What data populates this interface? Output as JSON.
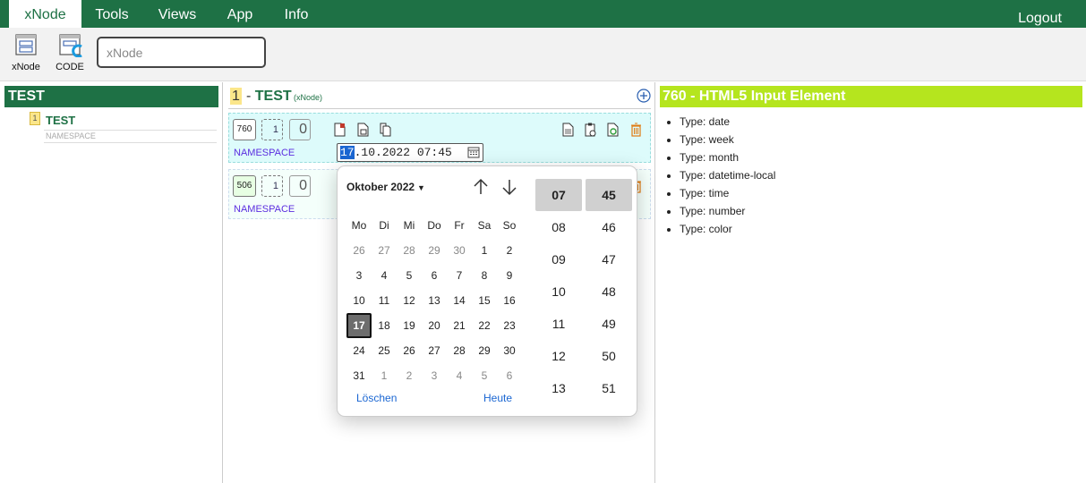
{
  "menubar": {
    "items": [
      {
        "label": "xNode",
        "active": true
      },
      {
        "label": "Tools"
      },
      {
        "label": "Views"
      },
      {
        "label": "App"
      },
      {
        "label": "Info"
      }
    ],
    "logout": "Logout"
  },
  "toolbar": {
    "xnode_label": "xNode",
    "code_label": "CODE",
    "search_placeholder": "xNode"
  },
  "tree": {
    "header": "TEST",
    "badge": "1",
    "name": "TEST",
    "namespace": "NAMESPACE"
  },
  "middle": {
    "badge": "1",
    "dash": "-",
    "title": "TEST",
    "subtitle": "(xNode)",
    "cards": [
      {
        "id": "760",
        "num": "1",
        "count": "0",
        "namespace": "NAMESPACE",
        "date_sel": "17",
        "date_rest": ".10.2022 07:45"
      },
      {
        "id": "506",
        "num": "1",
        "count": "0",
        "namespace": "NAMESPACE"
      }
    ]
  },
  "picker": {
    "month": "Oktober 2022",
    "weekdays": [
      "Mo",
      "Di",
      "Mi",
      "Do",
      "Fr",
      "Sa",
      "So"
    ],
    "weeks": [
      [
        "26",
        "27",
        "28",
        "29",
        "30",
        "1",
        "2"
      ],
      [
        "3",
        "4",
        "5",
        "6",
        "7",
        "8",
        "9"
      ],
      [
        "10",
        "11",
        "12",
        "13",
        "14",
        "15",
        "16"
      ],
      [
        "17",
        "18",
        "19",
        "20",
        "21",
        "22",
        "23"
      ],
      [
        "24",
        "25",
        "26",
        "27",
        "28",
        "29",
        "30"
      ],
      [
        "31",
        "1",
        "2",
        "3",
        "4",
        "5",
        "6"
      ]
    ],
    "selected_day": "17",
    "clear_label": "Löschen",
    "today_label": "Heute",
    "hours": [
      "07",
      "08",
      "09",
      "10",
      "11",
      "12",
      "13"
    ],
    "minutes": [
      "45",
      "46",
      "47",
      "48",
      "49",
      "50",
      "51"
    ],
    "selected_hour": "07",
    "selected_minute": "45"
  },
  "detail": {
    "title": "760 - HTML5 Input Element",
    "types": [
      "Type: date",
      "Type: week",
      "Type: month",
      "Type: datetime-local",
      "Type: time",
      "Type: number",
      "Type: color"
    ]
  },
  "colors": {
    "brand_green": "#1e7145",
    "lime": "#b5e51e",
    "selection_blue": "#1a66d2",
    "card_cyan": "#ddfbfb"
  }
}
